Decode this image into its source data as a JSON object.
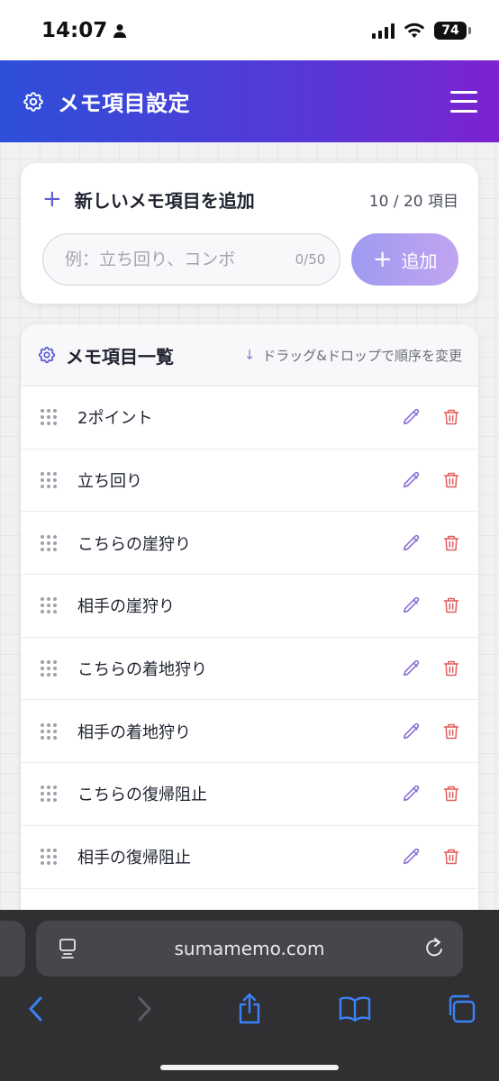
{
  "status_bar": {
    "time": "14:07",
    "battery": "74"
  },
  "header": {
    "title": "メモ項目設定"
  },
  "add_section": {
    "title": "新しいメモ項目を追加",
    "count": "10 / 20 項目",
    "input_placeholder": "例：立ち回り、コンボ",
    "char_count": "0/50",
    "add_button_label": "追加"
  },
  "list_section": {
    "title": "メモ項目一覧",
    "hint": "ドラッグ&ドロップで順序を変更",
    "items": [
      {
        "label": "2ポイント"
      },
      {
        "label": "立ち回り"
      },
      {
        "label": "こちらの崖狩り"
      },
      {
        "label": "相手の崖狩り"
      },
      {
        "label": "こちらの着地狩り"
      },
      {
        "label": "相手の着地狩り"
      },
      {
        "label": "こちらの復帰阻止"
      },
      {
        "label": "相手の復帰阻止"
      }
    ]
  },
  "browser": {
    "url": "sumamemo.com"
  },
  "colors": {
    "accent": "#5b5bd6",
    "edit_icon": "#8b6fd6",
    "delete_icon": "#e05d5d",
    "header_start": "#2d4fd9",
    "header_end": "#7c22d0"
  }
}
